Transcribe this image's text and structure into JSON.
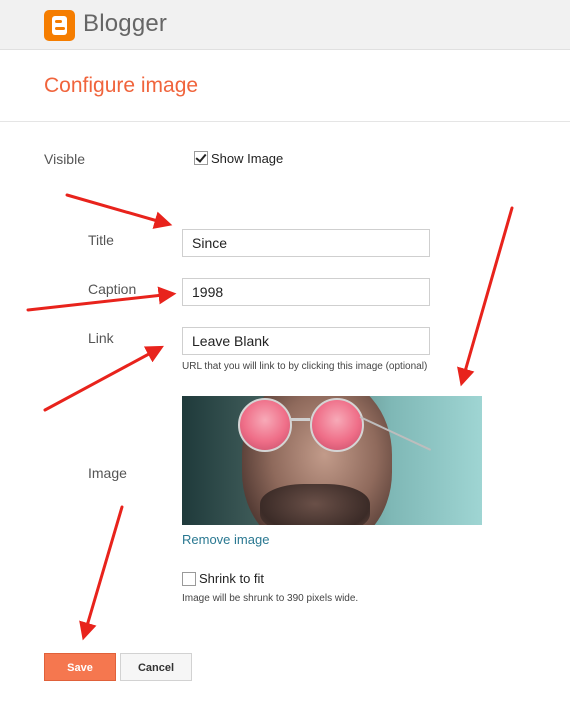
{
  "header": {
    "brand": "Blogger"
  },
  "page": {
    "title": "Configure image"
  },
  "form": {
    "visible_label": "Visible",
    "show_image_label": "Show Image",
    "show_image_checked": true,
    "title_label": "Title",
    "title_value": "Since",
    "caption_label": "Caption",
    "caption_value": "1998",
    "link_label": "Link",
    "link_value": "Leave Blank",
    "link_hint": "URL that you will link to by clicking this image (optional)",
    "image_label": "Image",
    "remove_image": "Remove image",
    "shrink_label": "Shrink to fit",
    "shrink_checked": false,
    "shrink_hint": "Image will be shrunk to 390 pixels wide."
  },
  "buttons": {
    "save": "Save",
    "cancel": "Cancel"
  },
  "colors": {
    "accent": "#f0643c",
    "arrow": "#e8231c",
    "link": "#2a7891",
    "logo": "#f57d00"
  }
}
